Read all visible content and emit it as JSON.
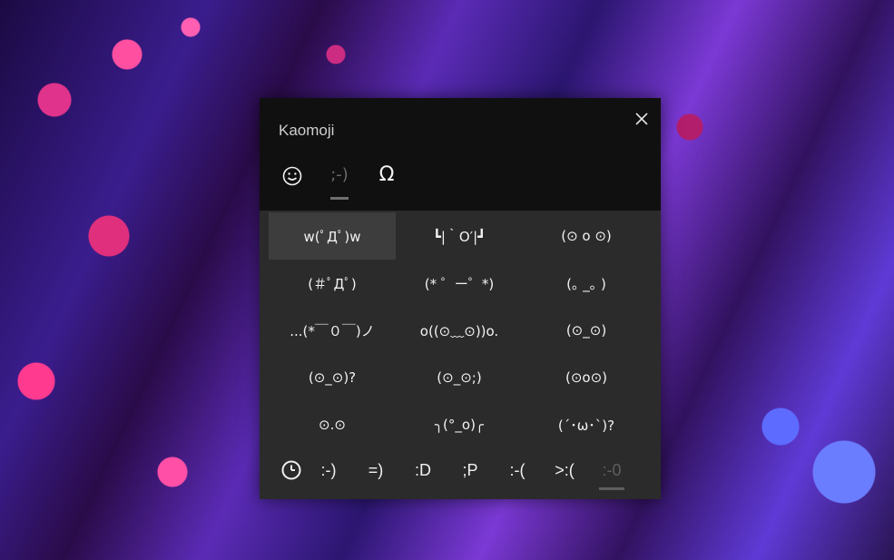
{
  "panel": {
    "title": "Kaomoji",
    "tabs": [
      {
        "name": "emoji",
        "icon": "smiley-face-icon"
      },
      {
        "name": "kaomoji",
        "label": ";-)"
      },
      {
        "name": "symbols",
        "label": "Ω"
      }
    ],
    "kaomoji": [
      [
        "w(ﾟДﾟ)w",
        "┗|｀O′|┛",
        "(⊙ o ⊙)"
      ],
      [
        "(＃ﾟДﾟ)",
        "(* ゜ー゜*)",
        "(｡ _｡ )"
      ],
      [
        "...(*￣０￣)ノ",
        "o((⊙﹏⊙))o.",
        "(⊙_⊙)"
      ],
      [
        "(⊙_⊙)?",
        "(⊙_⊙;)",
        "(⊙o⊙)"
      ],
      [
        "⊙.⊙",
        "╮(°_o)╭",
        "(´･ω･`)?"
      ]
    ],
    "bottom_tabs": [
      ":-)",
      "=)",
      ":D",
      ";P",
      ":-(",
      ">:(",
      ":-0"
    ]
  }
}
